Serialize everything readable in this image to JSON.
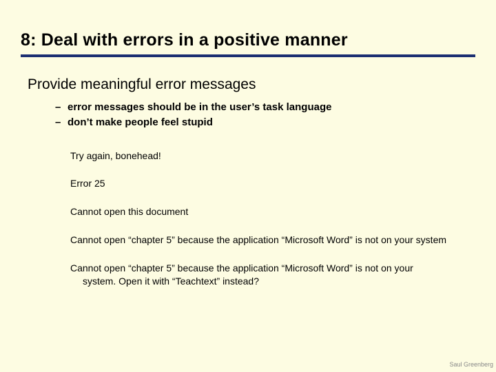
{
  "title": "8: Deal with errors in a positive manner",
  "subtitle": "Provide meaningful error messages",
  "bullets": [
    "error messages should be in the user’s task language",
    "don’t make people feel stupid"
  ],
  "examples": [
    "Try again, bonehead!",
    "Error 25",
    "Cannot open this document",
    "Cannot open “chapter 5” because the application “Microsoft Word” is not on your system",
    "Cannot open “chapter 5” because the application “Microsoft Word” is not on your system. Open it with “Teachtext” instead?"
  ],
  "footer": "Saul Greenberg"
}
